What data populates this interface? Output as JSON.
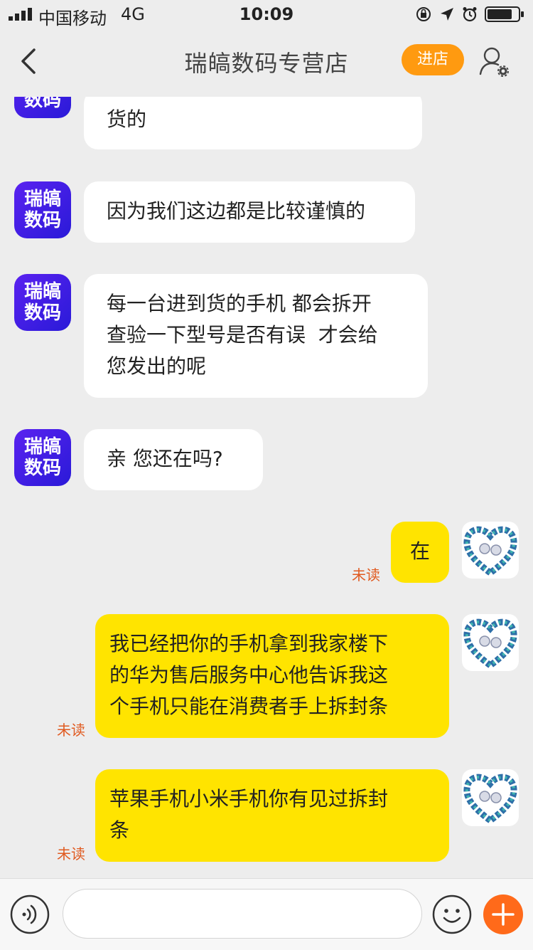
{
  "status_bar": {
    "carrier": "中国移动",
    "network": "4G",
    "time": "10:09",
    "icons": [
      "signal-icon",
      "orientation-lock-icon",
      "location-icon",
      "alarm-icon",
      "battery-icon"
    ]
  },
  "nav": {
    "back_icon": "chevron-left-icon",
    "title": "瑞皜数码专营店",
    "enter_store": "进店",
    "user_settings_icon": "user-settings-icon",
    "accent": "#ff9a10"
  },
  "shop_avatar": {
    "line1": "瑞皜",
    "line2": "数码"
  },
  "messages": [
    {
      "from": "shop",
      "text": "货的"
    },
    {
      "from": "shop",
      "text": "因为我们这边都是比较谨慎的"
    },
    {
      "from": "shop",
      "line1": "每一台进到货的手机 都会拆开",
      "line2": "查验一下型号是否有误  才会给",
      "line3": "您发出的呢"
    },
    {
      "from": "shop",
      "text": "亲 您还在吗?"
    },
    {
      "from": "me",
      "text": "在",
      "status": "未读"
    },
    {
      "from": "me",
      "line1": "我已经把你的手机拿到我家楼下",
      "line2": "的华为售后服务中心他告诉我这",
      "line3": "个手机只能在消费者手上拆封条",
      "status": "未读"
    },
    {
      "from": "me",
      "line1": "苹果手机小米手机你有见过拆封",
      "line2": "条",
      "status": "未读"
    }
  ],
  "input_bar": {
    "voice_icon": "voice-icon",
    "placeholder": "",
    "emoji_icon": "emoji-icon",
    "plus_icon": "plus-icon",
    "plus_color": "#ff6a1a"
  },
  "colors": {
    "outgoing_bubble": "#ffe400",
    "incoming_bubble": "#ffffff",
    "unread": "#e05a20"
  }
}
